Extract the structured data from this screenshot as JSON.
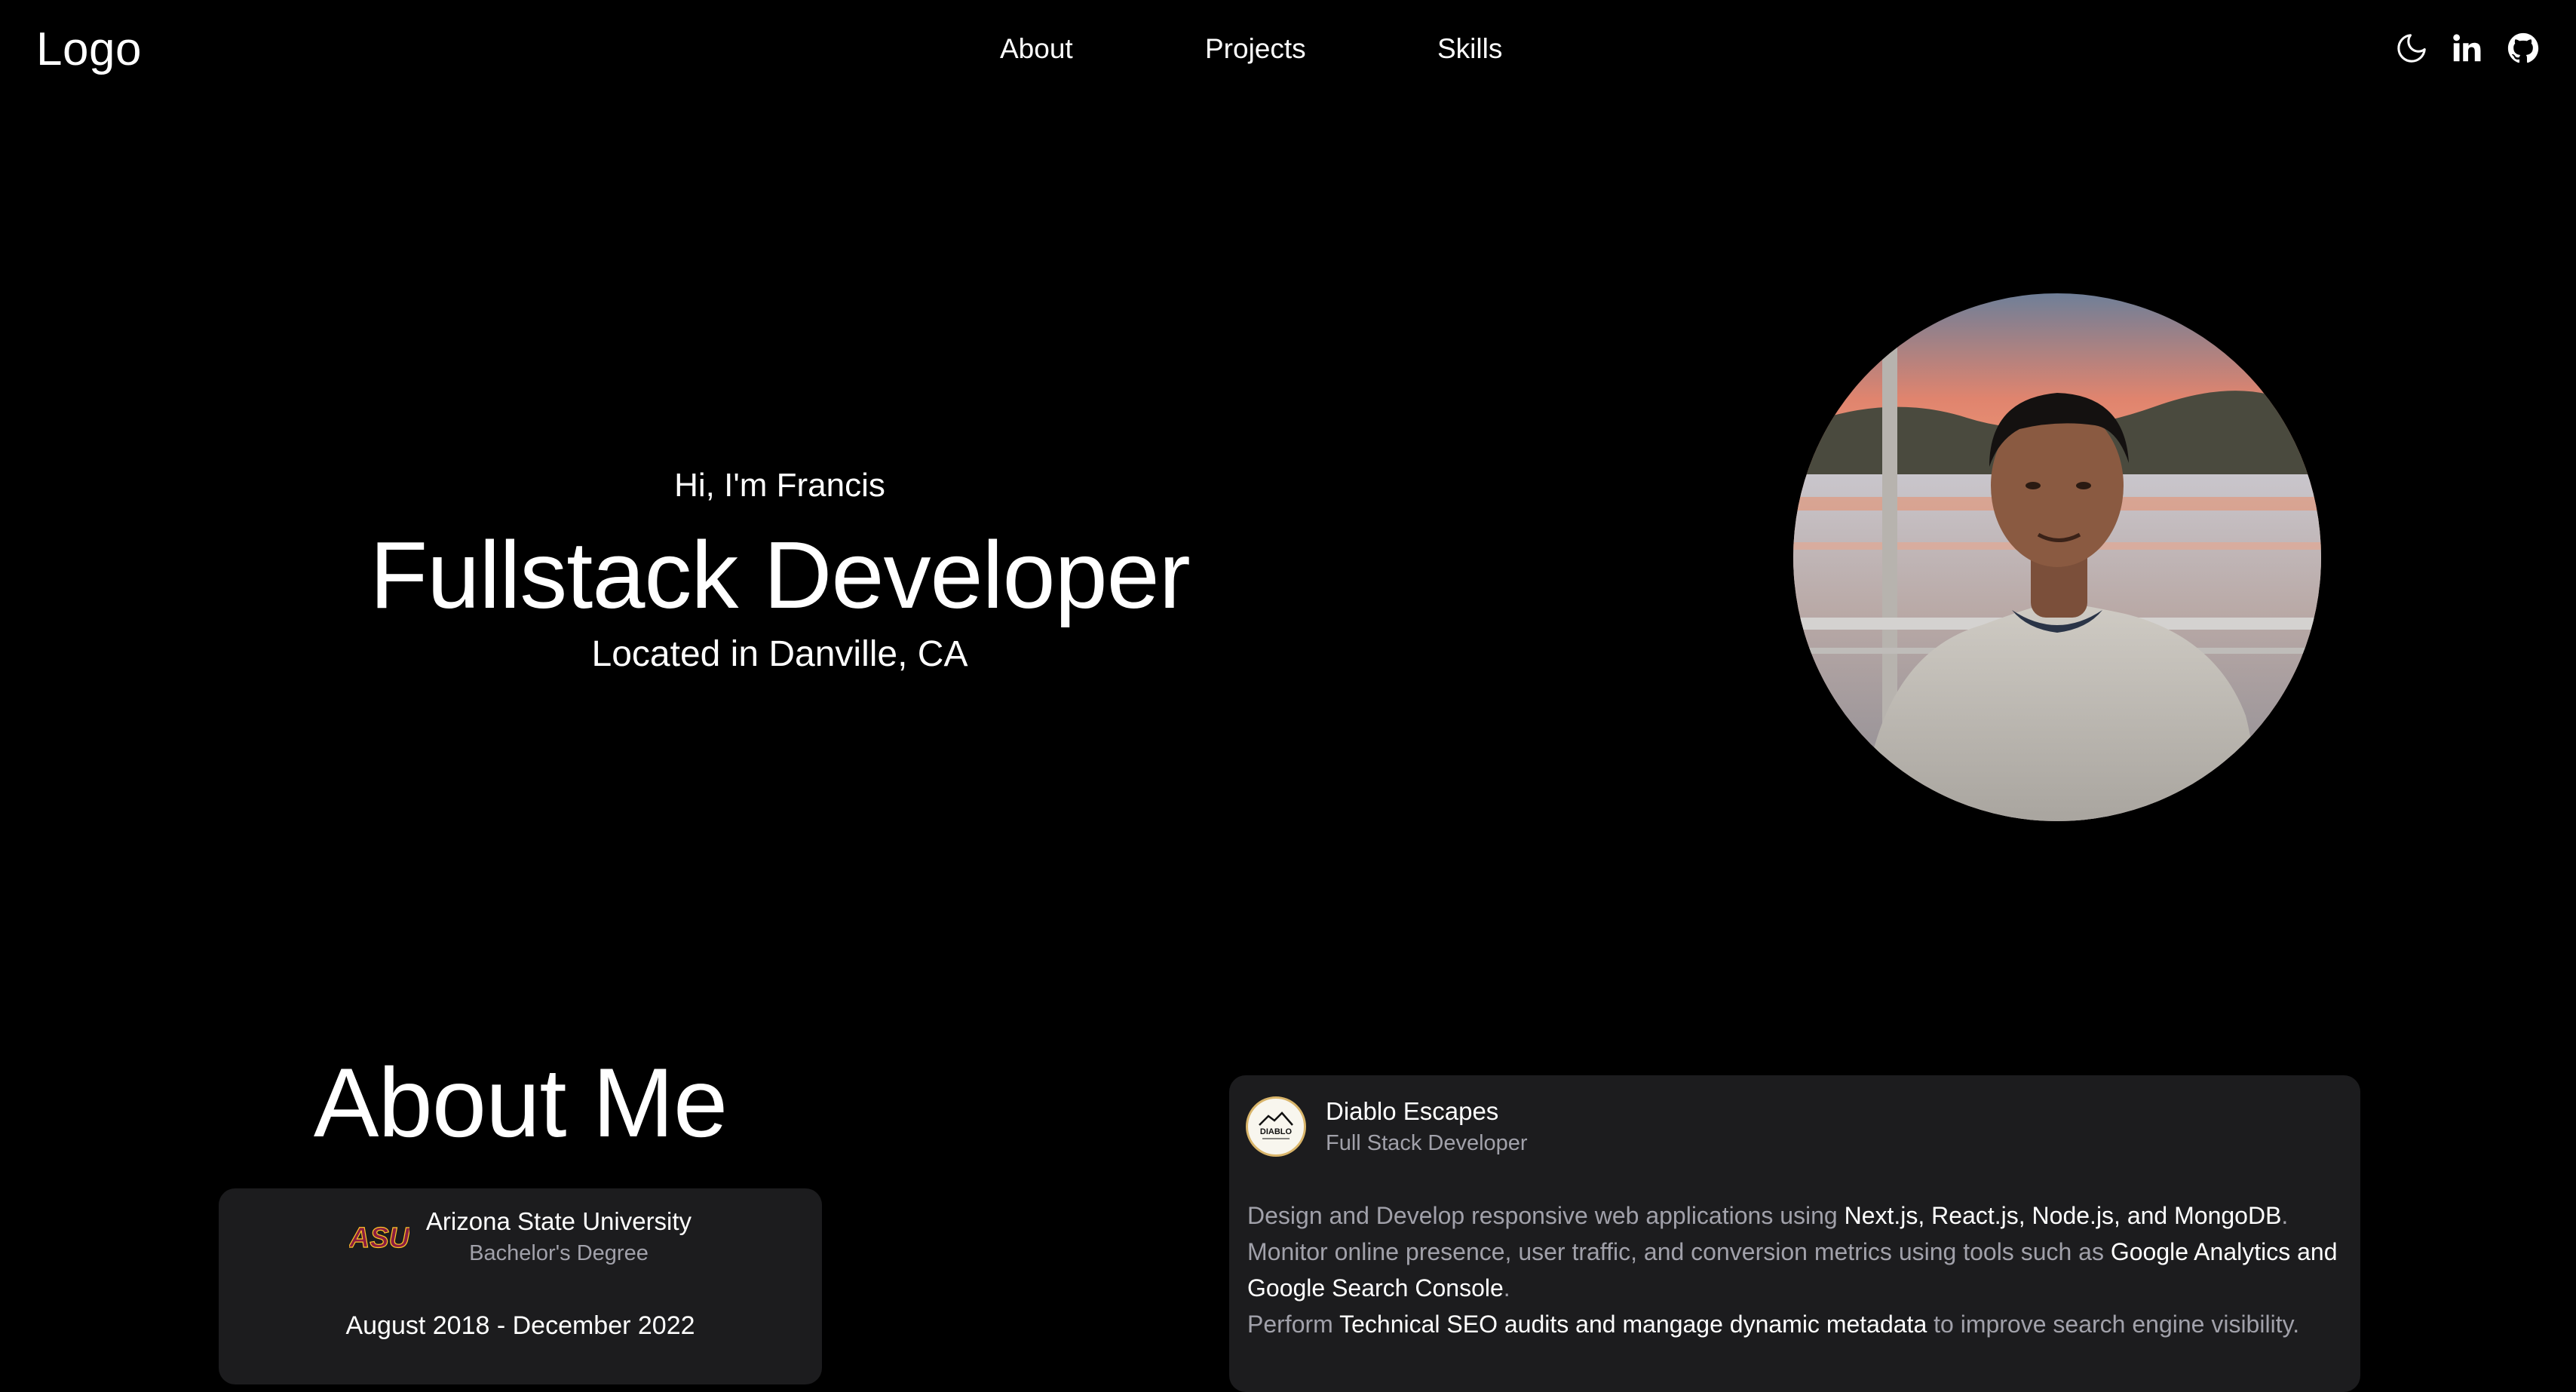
{
  "navbar": {
    "logo": "Logo",
    "links": {
      "about": "About",
      "projects": "Projects",
      "skills": "Skills"
    },
    "icons": [
      "moon-icon",
      "linkedin-icon",
      "github-icon"
    ]
  },
  "hero": {
    "greeting": "Hi, I'm Francis",
    "title": "Fullstack Developer",
    "location": "Located in Danville, CA"
  },
  "about": {
    "heading": "About Me",
    "education": {
      "school": "Arizona State University",
      "degree": "Bachelor's Degree",
      "dates": "August 2018 - December 2022",
      "logo_text": "ASU"
    },
    "experience": {
      "company": "Diablo Escapes",
      "role": "Full Stack Developer",
      "logo_text": "DIABLO",
      "lines": [
        {
          "p1": "Design and Develop responsive web applications using ",
          "h1": "Next.js, React.js, Node.js, and MongoDB",
          "p2": "."
        },
        {
          "p1": "Monitor online presence, user traffic, and conversion metrics using tools such as ",
          "h1": "Google Analytics and Google Search Console",
          "p2": "."
        },
        {
          "p1": "Perform ",
          "h1": "Technical SEO audits and mangage dynamic metadata",
          "p2": " to improve search engine visibility."
        }
      ]
    }
  },
  "colors": {
    "background": "#000000",
    "card": "#1c1c1e",
    "text": "#ffffff",
    "muted": "#a1a1aa",
    "asu_maroon": "#8c1d40",
    "asu_gold": "#ffc627"
  }
}
